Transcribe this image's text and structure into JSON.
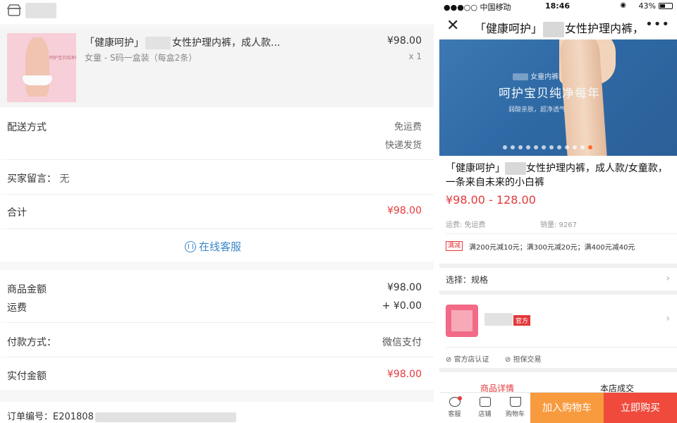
{
  "order": {
    "product": {
      "title_prefix": "「健康呵护」",
      "title_suffix": "女性护理内裤，成人款...",
      "spec": "女童 - S码一盒装（每盒2条）",
      "price": "¥98.00",
      "qty": "x 1",
      "thumb_text": "呵护宝贝纯净每年"
    },
    "delivery": {
      "label": "配送方式",
      "fee": "免运费",
      "method": "快递发货"
    },
    "message": {
      "label": "买家留言：",
      "value": "无"
    },
    "total": {
      "label": "合计",
      "value": "¥98.00"
    },
    "service_label": "在线客服",
    "amounts": {
      "goods_label": "商品金额",
      "goods_value": "¥98.00",
      "ship_label": "运费",
      "ship_value": "+ ¥0.00"
    },
    "payment": {
      "label": "付款方式：",
      "value": "微信支付"
    },
    "paid": {
      "label": "实付金额",
      "value": "¥98.00"
    },
    "order_no": {
      "label": "订单编号：E201808"
    }
  },
  "phone": {
    "status": {
      "carrier": "●●●○○ 中国移动",
      "time": "18:46",
      "battery": "43%"
    },
    "nav": {
      "title_prefix": "「健康呵护」",
      "title_suffix": "女性护理内裤，",
      "more": "•••",
      "close": "✕"
    },
    "banner": {
      "line1": "女童内裤",
      "line2": "呵护宝贝纯净每年",
      "line3": "弱酸亲肤，超净透气",
      "dot_count": 12,
      "active_dot": 11
    },
    "item": {
      "title_prefix": "「健康呵护」",
      "title_suffix": "女性护理内裤，成人款/女童款，一条来自未来的小白裤",
      "price": "¥98.00 - 128.00",
      "shipping": "运费: 免运费",
      "sales": "销量: 9267",
      "promo_badge": "满减",
      "promo_text": "满200元减10元；满300元减20元；满400元减40元"
    },
    "spec_row": {
      "label": "选择：规格"
    },
    "store": {
      "tag": "官方",
      "cert1": "官方店认证",
      "cert2": "担保交易"
    },
    "tabs": {
      "detail": "商品详情",
      "deals": "本店成交"
    },
    "bottom": {
      "service": "客服",
      "shop": "店铺",
      "cart": "购物车",
      "add_cart": "加入购物车",
      "buy_now": "立即购买"
    }
  },
  "colors": {
    "price_red": "#e4393c",
    "link_blue": "#3a86c8",
    "cart_orange": "#f89a3e",
    "buy_red": "#ef4a3c"
  }
}
